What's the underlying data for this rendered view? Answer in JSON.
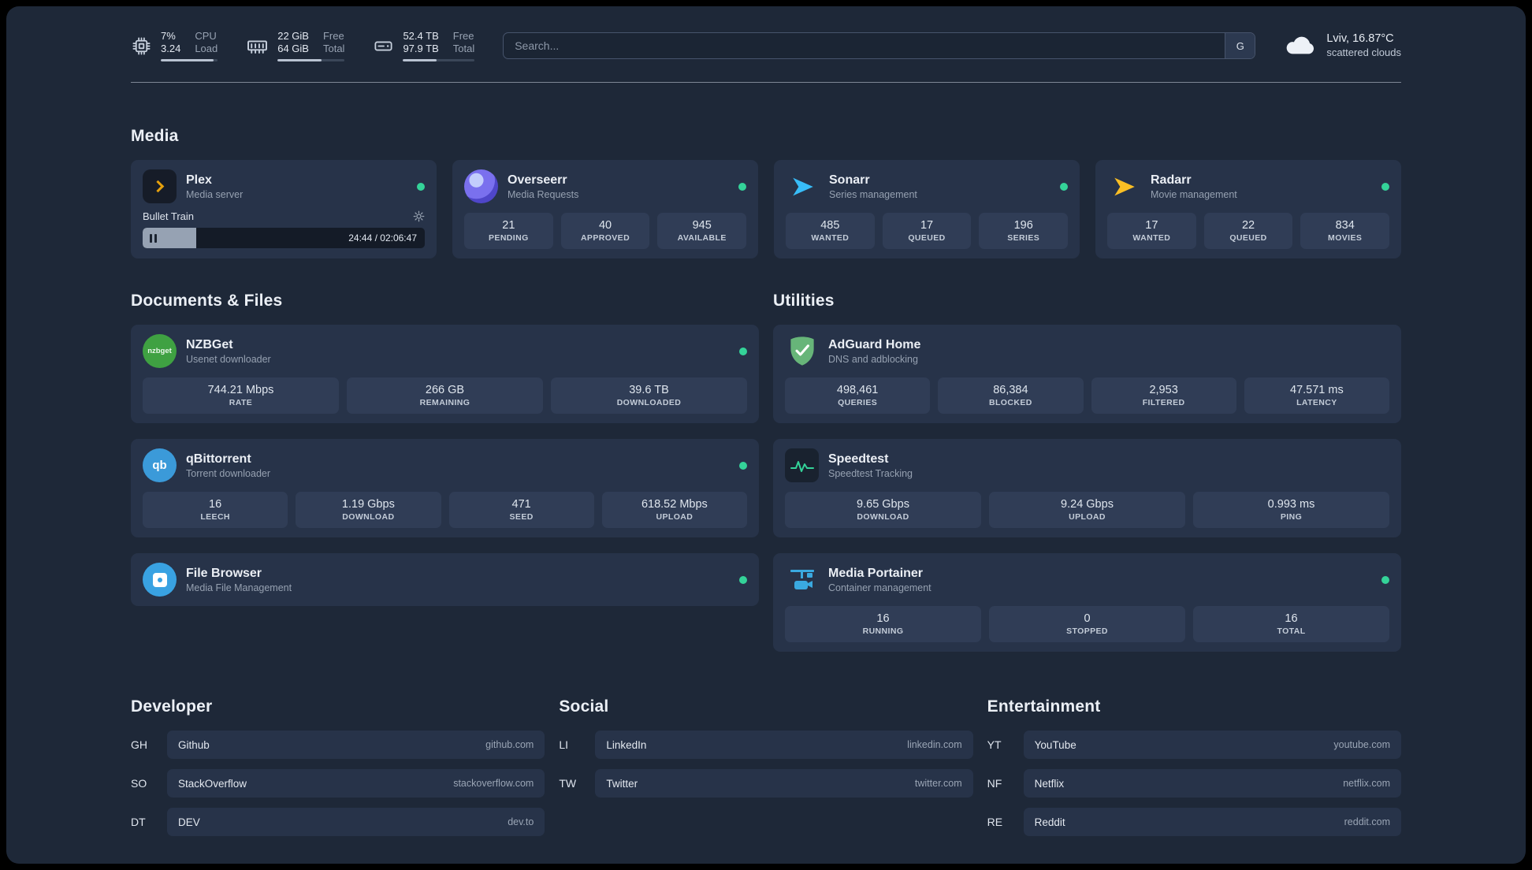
{
  "colors": {
    "status_online": "#34d399",
    "plex_accent": "#e5a00d"
  },
  "topbar": {
    "cpu": {
      "value1": "7%",
      "value2": "3.24",
      "label1": "CPU",
      "label2": "Load",
      "progress_pct": 93
    },
    "ram": {
      "value1": "22 GiB",
      "value2": "64 GiB",
      "label1": "Free",
      "label2": "Total",
      "progress_pct": 66
    },
    "disk": {
      "value1": "52.4 TB",
      "value2": "97.9 TB",
      "label1": "Free",
      "label2": "Total",
      "progress_pct": 47
    },
    "search": {
      "placeholder": "Search...",
      "engine_label": "G"
    },
    "weather": {
      "location": "Lviv, 16.87°C",
      "condition": "scattered clouds"
    }
  },
  "media": {
    "title": "Media",
    "plex": {
      "name": "Plex",
      "desc": "Media server",
      "now_playing": "Bullet Train",
      "time": "24:44 / 02:06:47",
      "progress_pct": 19
    },
    "overseerr": {
      "name": "Overseerr",
      "desc": "Media Requests",
      "stats": [
        {
          "value": "21",
          "label": "PENDING"
        },
        {
          "value": "40",
          "label": "APPROVED"
        },
        {
          "value": "945",
          "label": "AVAILABLE"
        }
      ]
    },
    "sonarr": {
      "name": "Sonarr",
      "desc": "Series management",
      "stats": [
        {
          "value": "485",
          "label": "WANTED"
        },
        {
          "value": "17",
          "label": "QUEUED"
        },
        {
          "value": "196",
          "label": "SERIES"
        }
      ]
    },
    "radarr": {
      "name": "Radarr",
      "desc": "Movie management",
      "stats": [
        {
          "value": "17",
          "label": "WANTED"
        },
        {
          "value": "22",
          "label": "QUEUED"
        },
        {
          "value": "834",
          "label": "MOVIES"
        }
      ]
    }
  },
  "documents": {
    "title": "Documents & Files",
    "nzbget": {
      "name": "NZBGet",
      "desc": "Usenet downloader",
      "icon_text": "nzbget",
      "stats": [
        {
          "value": "744.21 Mbps",
          "label": "RATE"
        },
        {
          "value": "266 GB",
          "label": "REMAINING"
        },
        {
          "value": "39.6 TB",
          "label": "DOWNLOADED"
        }
      ]
    },
    "qbittorrent": {
      "name": "qBittorrent",
      "desc": "Torrent downloader",
      "icon_text": "qb",
      "stats": [
        {
          "value": "16",
          "label": "LEECH"
        },
        {
          "value": "1.19 Gbps",
          "label": "DOWNLOAD"
        },
        {
          "value": "471",
          "label": "SEED"
        },
        {
          "value": "618.52 Mbps",
          "label": "UPLOAD"
        }
      ]
    },
    "filebrowser": {
      "name": "File Browser",
      "desc": "Media File Management"
    }
  },
  "utilities": {
    "title": "Utilities",
    "adguard": {
      "name": "AdGuard Home",
      "desc": "DNS and adblocking",
      "stats": [
        {
          "value": "498,461",
          "label": "QUERIES"
        },
        {
          "value": "86,384",
          "label": "BLOCKED"
        },
        {
          "value": "2,953",
          "label": "FILTERED"
        },
        {
          "value": "47.571 ms",
          "label": "LATENCY"
        }
      ]
    },
    "speedtest": {
      "name": "Speedtest",
      "desc": "Speedtest Tracking",
      "stats": [
        {
          "value": "9.65 Gbps",
          "label": "DOWNLOAD"
        },
        {
          "value": "9.24 Gbps",
          "label": "UPLOAD"
        },
        {
          "value": "0.993 ms",
          "label": "PING"
        }
      ]
    },
    "portainer": {
      "name": "Media Portainer",
      "desc": "Container management",
      "stats": [
        {
          "value": "16",
          "label": "RUNNING"
        },
        {
          "value": "0",
          "label": "STOPPED"
        },
        {
          "value": "16",
          "label": "TOTAL"
        }
      ]
    }
  },
  "bookmarks": {
    "developer": {
      "title": "Developer",
      "items": [
        {
          "abbr": "GH",
          "name": "Github",
          "url": "github.com"
        },
        {
          "abbr": "SO",
          "name": "StackOverflow",
          "url": "stackoverflow.com"
        },
        {
          "abbr": "DT",
          "name": "DEV",
          "url": "dev.to"
        }
      ]
    },
    "social": {
      "title": "Social",
      "items": [
        {
          "abbr": "LI",
          "name": "LinkedIn",
          "url": "linkedin.com"
        },
        {
          "abbr": "TW",
          "name": "Twitter",
          "url": "twitter.com"
        }
      ]
    },
    "entertainment": {
      "title": "Entertainment",
      "items": [
        {
          "abbr": "YT",
          "name": "YouTube",
          "url": "youtube.com"
        },
        {
          "abbr": "NF",
          "name": "Netflix",
          "url": "netflix.com"
        },
        {
          "abbr": "RE",
          "name": "Reddit",
          "url": "reddit.com"
        }
      ]
    }
  }
}
